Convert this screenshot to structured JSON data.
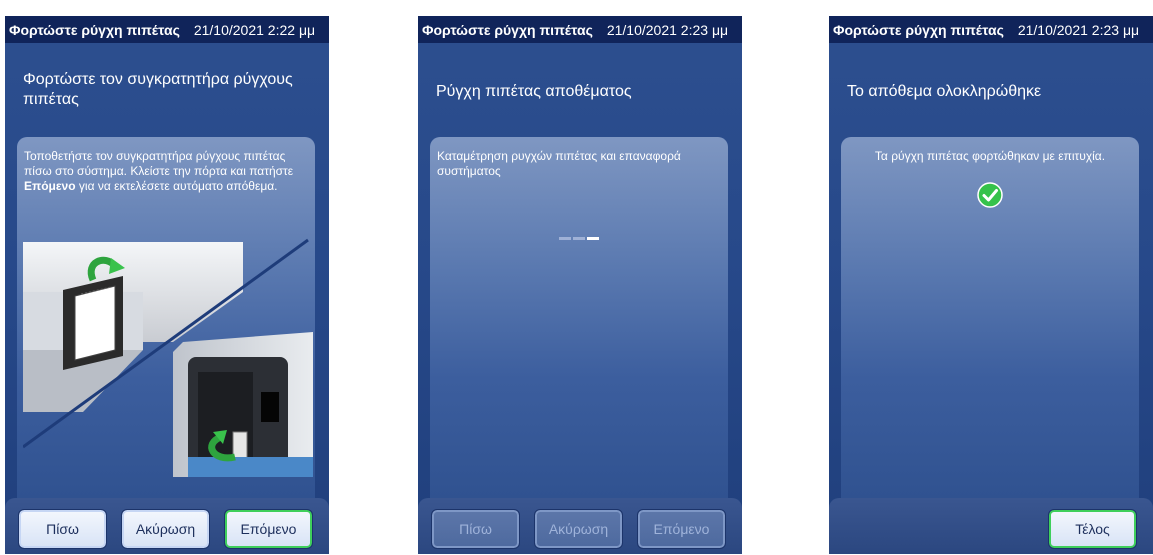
{
  "screens": [
    {
      "title": "Φορτώστε ρύγχη πιπέτας",
      "datetime": "21/10/2021 2:22 μμ",
      "heading": "Φορτώστε τον συγκρατητήρα ρύγχους πιπέτας",
      "instruction_pre": "Τοποθετήστε τον συγκρατητήρα ρύγχους πιπέτας πίσω στο σύστημα. Κλείστε την πόρτα και πατήστε ",
      "instruction_bold": "Επόμενο",
      "instruction_post": " για να εκτελέσετε αυτόματο απόθεμα.",
      "buttons": {
        "back": "Πίσω",
        "cancel": "Ακύρωση",
        "next": "Επόμενο"
      }
    },
    {
      "title": "Φορτώστε ρύγχη πιπέτας",
      "datetime": "21/10/2021 2:23 μμ",
      "heading": "Ρύγχη πιπέτας αποθέματος",
      "status": "Καταμέτρηση ρυγχών πιπέτας και επαναφορά συστήματος",
      "progress_icon": "progress-dots-icon",
      "buttons": {
        "back": "Πίσω",
        "cancel": "Ακύρωση",
        "next": "Επόμενο"
      }
    },
    {
      "title": "Φορτώστε ρύγχη πιπέτας",
      "datetime": "21/10/2021 2:23 μμ",
      "heading": "Το απόθεμα ολοκληρώθηκε",
      "message": "Τα ρύγχη πιπέτας φορτώθηκαν με επιτυχία.",
      "success_icon": "check-circle-icon",
      "buttons": {
        "finish": "Τέλος"
      }
    }
  ],
  "colors": {
    "titlebar": "#10245a",
    "screen_bg": "#27498a",
    "next_border": "#3fcf5b",
    "success_green": "#35c24a"
  }
}
